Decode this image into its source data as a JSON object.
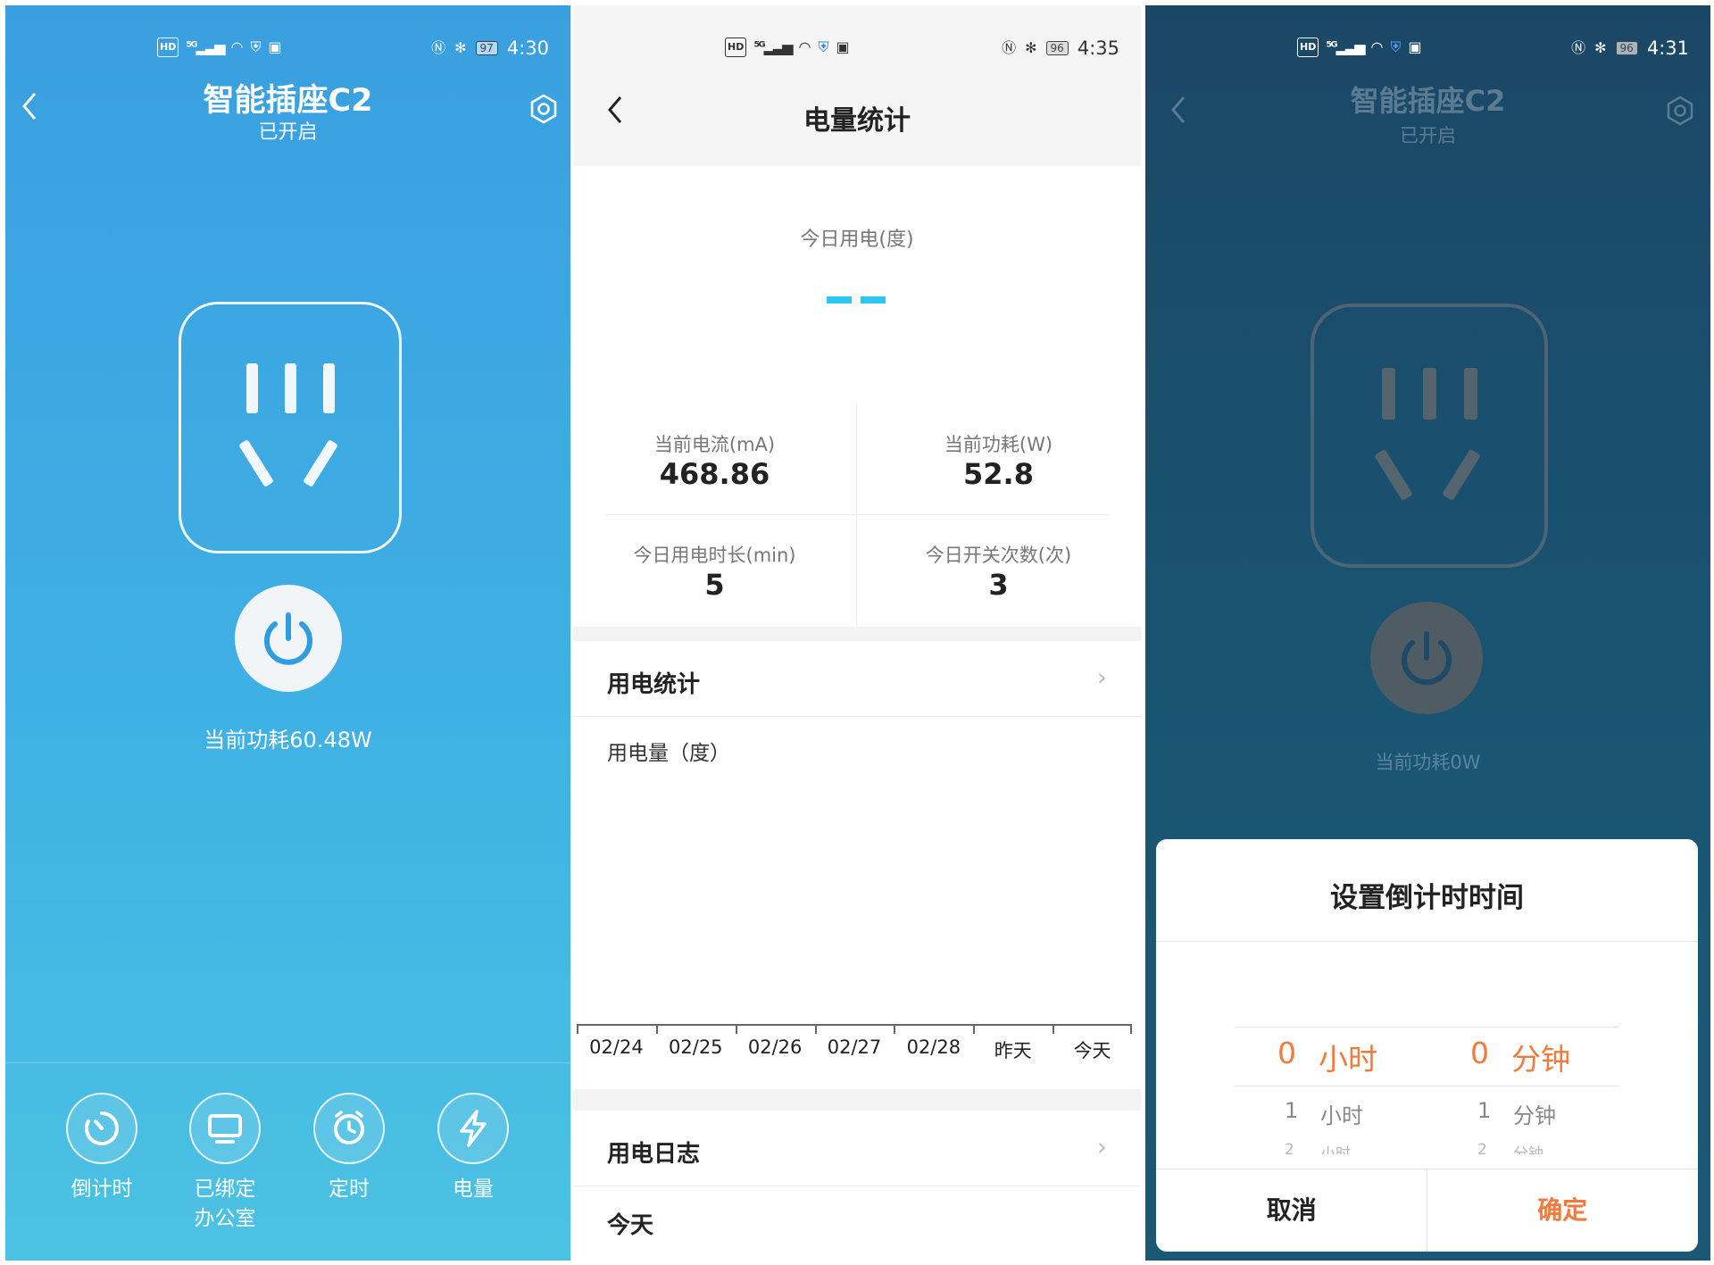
{
  "panel1": {
    "status": {
      "battery": "97",
      "time": "4:30",
      "signal": "5G"
    },
    "device_name": "智能插座C2",
    "device_status": "已开启",
    "power_text": "当前功耗60.48W",
    "nav": [
      {
        "label": "倒计时",
        "icon": "countdown-icon"
      },
      {
        "label": "已绑定\n办公室",
        "icon": "monitor-icon"
      },
      {
        "label": "定时",
        "icon": "alarm-clock-icon"
      },
      {
        "label": "电量",
        "icon": "lightning-icon"
      }
    ],
    "colors": {
      "bg_top": "#3a9fe0",
      "bg_bottom": "#4cc2e3",
      "power_icon": "#2e9ee0"
    }
  },
  "panel2": {
    "status": {
      "battery": "96",
      "time": "4:35",
      "signal": "5G"
    },
    "title": "电量统计",
    "today_label": "今日用电(度)",
    "stats": [
      {
        "label": "当前电流(mA)",
        "value": "468.86"
      },
      {
        "label": "当前功耗(W)",
        "value": "52.8"
      },
      {
        "label": "今日用电时长(min)",
        "value": "5"
      },
      {
        "label": "今日开关次数(次)",
        "value": "3"
      }
    ],
    "usage_section": "用电统计",
    "chart_ylabel": "用电量（度）",
    "chart_data": {
      "type": "bar",
      "categories": [
        "02/24",
        "02/25",
        "02/26",
        "02/27",
        "02/28",
        "昨天",
        "今天"
      ],
      "values": [],
      "ylabel": "用电量（度）",
      "grid": false
    },
    "log_section": "用电日志",
    "log_first": "今天",
    "colors": {
      "dash": "#2fc7ef"
    }
  },
  "panel3": {
    "status": {
      "battery": "96",
      "time": "4:31",
      "signal": "5G"
    },
    "device_name": "智能插座C2",
    "device_status": "已开启",
    "power_text": "当前功耗0W",
    "dialog": {
      "title": "设置倒计时时间",
      "hours": [
        {
          "num": "0",
          "unit": "小时"
        },
        {
          "num": "1",
          "unit": "小时"
        },
        {
          "num": "2",
          "unit": "小时"
        }
      ],
      "minutes": [
        {
          "num": "0",
          "unit": "分钟"
        },
        {
          "num": "1",
          "unit": "分钟"
        },
        {
          "num": "2",
          "unit": "分钟"
        }
      ],
      "cancel": "取消",
      "confirm": "确定"
    },
    "colors": {
      "accent": "#f27a3c"
    }
  }
}
